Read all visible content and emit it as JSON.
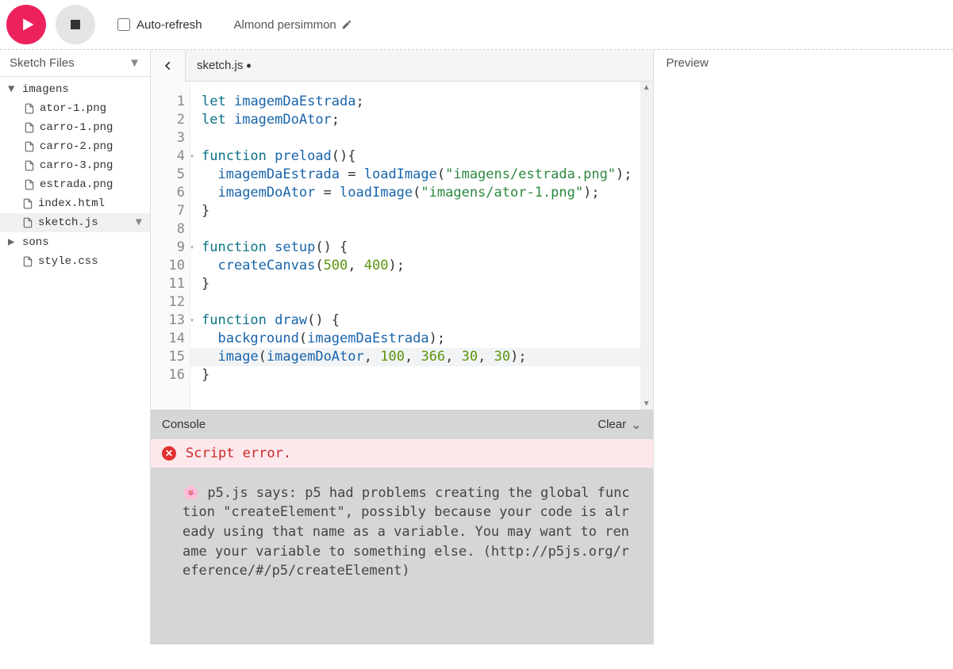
{
  "toolbar": {
    "auto_refresh_label": "Auto-refresh",
    "sketch_name": "Almond persimmon"
  },
  "sidebar": {
    "title": "Sketch Files",
    "tree": [
      {
        "name": "imagens",
        "type": "folder",
        "open": true
      },
      {
        "name": "ator-1.png",
        "type": "file",
        "child": true
      },
      {
        "name": "carro-1.png",
        "type": "file",
        "child": true
      },
      {
        "name": "carro-2.png",
        "type": "file",
        "child": true
      },
      {
        "name": "carro-3.png",
        "type": "file",
        "child": true
      },
      {
        "name": "estrada.png",
        "type": "file",
        "child": true
      },
      {
        "name": "index.html",
        "type": "file"
      },
      {
        "name": "sketch.js",
        "type": "file",
        "selected": true
      },
      {
        "name": "sons",
        "type": "folder",
        "open": false
      },
      {
        "name": "style.css",
        "type": "file"
      }
    ]
  },
  "editor": {
    "tab_name": "sketch.js",
    "dirty": true,
    "lines": [
      1,
      2,
      3,
      4,
      5,
      6,
      7,
      8,
      9,
      10,
      11,
      12,
      13,
      14,
      15,
      16
    ],
    "fold_lines": [
      4,
      9,
      13
    ],
    "code_tokens": [
      [
        [
          "kw",
          "let"
        ],
        [
          "pl",
          " "
        ],
        [
          "var",
          "imagemDaEstrada"
        ],
        [
          "pl",
          ";"
        ]
      ],
      [
        [
          "kw",
          "let"
        ],
        [
          "pl",
          " "
        ],
        [
          "var",
          "imagemDoAtor"
        ],
        [
          "pl",
          ";"
        ]
      ],
      [],
      [
        [
          "kw",
          "function"
        ],
        [
          "pl",
          " "
        ],
        [
          "fn",
          "preload"
        ],
        [
          "pl",
          "(){"
        ]
      ],
      [
        [
          "pl",
          "  "
        ],
        [
          "var",
          "imagemDaEstrada"
        ],
        [
          "pl",
          " = "
        ],
        [
          "fn",
          "loadImage"
        ],
        [
          "pl",
          "("
        ],
        [
          "str",
          "\"imagens/estrada.png\""
        ],
        [
          "pl",
          ");"
        ]
      ],
      [
        [
          "pl",
          "  "
        ],
        [
          "var",
          "imagemDoAtor"
        ],
        [
          "pl",
          " = "
        ],
        [
          "fn",
          "loadImage"
        ],
        [
          "pl",
          "("
        ],
        [
          "str",
          "\"imagens/ator-1.png\""
        ],
        [
          "pl",
          ");"
        ]
      ],
      [
        [
          "pl",
          "}"
        ]
      ],
      [],
      [
        [
          "kw",
          "function"
        ],
        [
          "pl",
          " "
        ],
        [
          "fn",
          "setup"
        ],
        [
          "pl",
          "() {"
        ]
      ],
      [
        [
          "pl",
          "  "
        ],
        [
          "fn",
          "createCanvas"
        ],
        [
          "pl",
          "("
        ],
        [
          "num",
          "500"
        ],
        [
          "pl",
          ", "
        ],
        [
          "num",
          "400"
        ],
        [
          "pl",
          ");"
        ]
      ],
      [
        [
          "pl",
          "}"
        ]
      ],
      [],
      [
        [
          "kw",
          "function"
        ],
        [
          "pl",
          " "
        ],
        [
          "fn",
          "draw"
        ],
        [
          "pl",
          "() {"
        ]
      ],
      [
        [
          "pl",
          "  "
        ],
        [
          "fn",
          "background"
        ],
        [
          "pl",
          "("
        ],
        [
          "var",
          "imagemDaEstrada"
        ],
        [
          "pl",
          ");"
        ]
      ],
      [
        [
          "pl",
          "  "
        ],
        [
          "fn",
          "image"
        ],
        [
          "pl",
          "("
        ],
        [
          "var",
          "imagemDoAtor"
        ],
        [
          "pl",
          ", "
        ],
        [
          "num",
          "100"
        ],
        [
          "pl",
          ", "
        ],
        [
          "num",
          "366"
        ],
        [
          "pl",
          ", "
        ],
        [
          "num",
          "30"
        ],
        [
          "pl",
          ", "
        ],
        [
          "num",
          "30"
        ],
        [
          "pl",
          ");"
        ]
      ],
      [
        [
          "pl",
          "}"
        ]
      ]
    ],
    "highlight_line": 15
  },
  "console": {
    "title": "Console",
    "clear_label": "Clear",
    "error_text": "Script error.",
    "message": "🌸 p5.js says: p5 had problems creating the global function \"createElement\", possibly because your code is already using that name as a variable. You may want to rename your variable to something else. (http://p5js.org/reference/#/p5/createElement)"
  },
  "preview": {
    "title": "Preview"
  }
}
